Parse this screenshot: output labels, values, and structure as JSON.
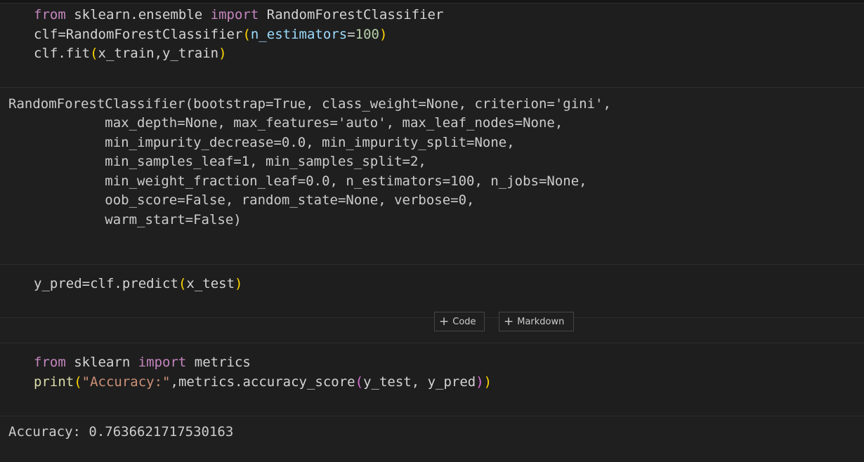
{
  "cells": [
    {
      "type": "code",
      "lines": [
        {
          "tokens": [
            {
              "t": "from",
              "c": "kw"
            },
            {
              "t": " sklearn.ensemble ",
              "c": "txt"
            },
            {
              "t": "import",
              "c": "kw"
            },
            {
              "t": " RandomForestClassifier",
              "c": "txt"
            }
          ]
        },
        {
          "tokens": [
            {
              "t": "clf",
              "c": "txt"
            },
            {
              "t": "=",
              "c": "op"
            },
            {
              "t": "RandomForestClassifier",
              "c": "txt"
            },
            {
              "t": "(",
              "c": "paren1"
            },
            {
              "t": "n_estimators",
              "c": "param"
            },
            {
              "t": "=",
              "c": "op"
            },
            {
              "t": "100",
              "c": "num"
            },
            {
              "t": ")",
              "c": "paren1"
            }
          ]
        },
        {
          "tokens": [
            {
              "t": "clf.fit",
              "c": "txt"
            },
            {
              "t": "(",
              "c": "paren1"
            },
            {
              "t": "x_train,y_train",
              "c": "txt"
            },
            {
              "t": ")",
              "c": "paren1"
            }
          ]
        }
      ]
    },
    {
      "type": "output",
      "lines": [
        "RandomForestClassifier(bootstrap=True, class_weight=None, criterion='gini',",
        "            max_depth=None, max_features='auto', max_leaf_nodes=None,",
        "            min_impurity_decrease=0.0, min_impurity_split=None,",
        "            min_samples_leaf=1, min_samples_split=2,",
        "            min_weight_fraction_leaf=0.0, n_estimators=100, n_jobs=None,",
        "            oob_score=False, random_state=None, verbose=0,",
        "            warm_start=False)"
      ]
    },
    {
      "type": "code",
      "lines": [
        {
          "tokens": [
            {
              "t": "y_pred",
              "c": "txt"
            },
            {
              "t": "=",
              "c": "op"
            },
            {
              "t": "clf.predict",
              "c": "txt"
            },
            {
              "t": "(",
              "c": "paren1"
            },
            {
              "t": "x_test",
              "c": "txt"
            },
            {
              "t": ")",
              "c": "paren1"
            }
          ]
        }
      ]
    },
    {
      "type": "code",
      "lines": [
        {
          "tokens": [
            {
              "t": "from",
              "c": "kw"
            },
            {
              "t": " sklearn ",
              "c": "txt"
            },
            {
              "t": "import",
              "c": "kw"
            },
            {
              "t": " metrics",
              "c": "txt"
            }
          ]
        },
        {
          "tokens": [
            {
              "t": "print",
              "c": "fn"
            },
            {
              "t": "(",
              "c": "paren1"
            },
            {
              "t": "\"Accuracy:\"",
              "c": "str"
            },
            {
              "t": ",metrics.accuracy_score",
              "c": "txt"
            },
            {
              "t": "(",
              "c": "paren2"
            },
            {
              "t": "y_test, y_pred",
              "c": "txt"
            },
            {
              "t": ")",
              "c": "paren2"
            },
            {
              "t": ")",
              "c": "paren1"
            }
          ]
        }
      ]
    },
    {
      "type": "output",
      "lines": [
        "Accuracy: 0.7636621717530163"
      ]
    }
  ],
  "toolbar": {
    "add_code_label": "Code",
    "add_markdown_label": "Markdown"
  },
  "colors": {
    "background": "#1f1f1f",
    "keyword": "#c586c0",
    "param": "#9cdcfe",
    "number": "#b5cea8",
    "string": "#ce9178",
    "function": "#dcdcaa",
    "bracket1": "#ffd700",
    "bracket2": "#da70d6"
  }
}
